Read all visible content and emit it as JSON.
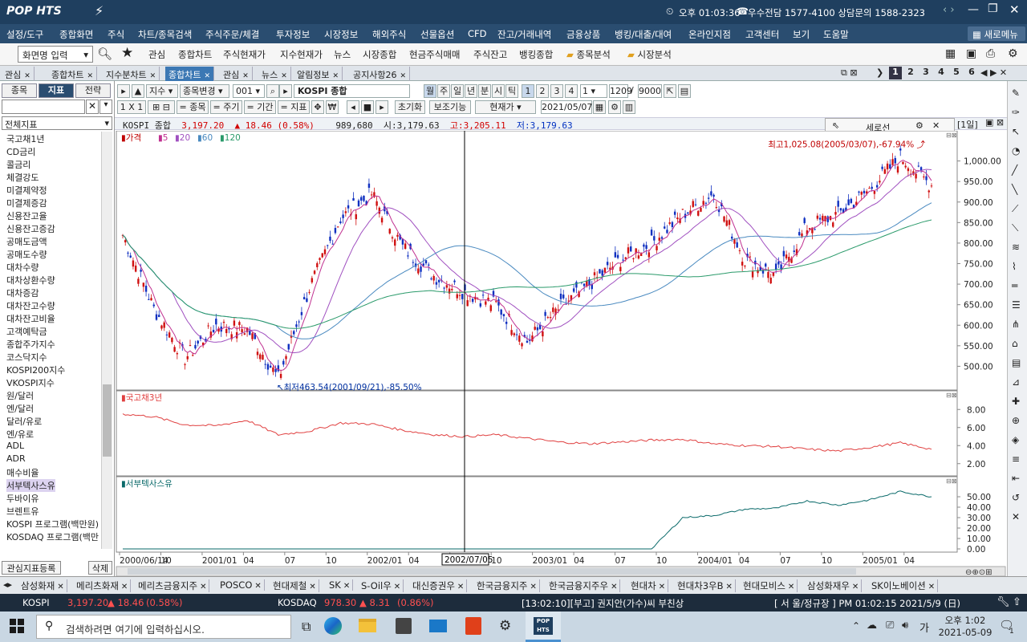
{
  "app": {
    "logo": "POP HTS",
    "clock": "오후 01:03:36",
    "contact": "우수전담 1577-4100 상담문의 1588-2323",
    "new_menu": "새로메뉴"
  },
  "menu": [
    "설정/도구",
    "종합화면",
    "주식",
    "차트/종목검색",
    "주식주문/체결",
    "투자정보",
    "시장정보",
    "해외주식",
    "선물옵션",
    "CFD",
    "잔고/거래내역",
    "금융상품",
    "뱅킹/대출/대여",
    "온라인지점",
    "고객센터",
    "보기",
    "도움말"
  ],
  "toolbar": {
    "screen_input": "화면명 입력",
    "links": [
      "관심",
      "종합차트",
      "주식현재가",
      "지수현재가",
      "뉴스",
      "시장종합",
      "현금주식매매",
      "주식잔고",
      "뱅킹종합"
    ],
    "folders": [
      "종목분석",
      "시장분석"
    ]
  },
  "window_tabs": [
    "관심",
    "종합차트",
    "지수분차트",
    "종합차트",
    "관심",
    "뉴스",
    "알림정보",
    "공지사항26"
  ],
  "window_tab_active": 3,
  "page_tabs": [
    "1",
    "2",
    "3",
    "4",
    "5",
    "6"
  ],
  "left": {
    "tabs": [
      "종목",
      "지표",
      "전략"
    ],
    "active_tab": 1,
    "filter": "전체지표",
    "items": [
      "국고채1년",
      "CD금리",
      "콜금리",
      "체결강도",
      "미결제약정",
      "미결제증감",
      "신용잔고율",
      "신용잔고증감",
      "공매도금액",
      "공매도수량",
      "대차수량",
      "대차상환수량",
      "대차증감",
      "대차잔고수량",
      "대차잔고비율",
      "고객예탁금",
      "종합주가지수",
      "코스닥지수",
      "KOSPI200지수",
      "VKOSPI지수",
      "원/달러",
      "엔/달러",
      "달러/유로",
      "엔/유로",
      "ADL",
      "ADR",
      "매수비율",
      "서부텍사스유",
      "두바이유",
      "브렌트유",
      "KOSPI 프로그램(백만원)",
      "KOSDAQ 프로그램(백만"
    ],
    "selected": "서부텍사스유",
    "register": "관심지표등록",
    "delete": "삭제"
  },
  "chart_ctrl": {
    "index_label": "지수",
    "change_label": "종목변경",
    "code": "001",
    "name": "KOSPI 종합",
    "periods": [
      "월",
      "주",
      "일",
      "년",
      "분",
      "시",
      "틱"
    ],
    "nums": [
      "1",
      "2",
      "3",
      "4"
    ],
    "count_sel": "1",
    "count1": "1209",
    "count2": "9000",
    "btn_a": "1 X 1",
    "btn_b": "= 종목",
    "btn_c": "= 주기",
    "btn_d": "= 기간",
    "btn_e": "= 지표",
    "reset": "초기화",
    "aux": "보조기능",
    "price_type": "현재가",
    "date": "2021/05/07"
  },
  "quote": {
    "name": "KOSPI 종합",
    "price": "3,197.20",
    "change": "▲ 18.46",
    "pct": "(0.58%)",
    "volume": "989,680",
    "open_label": "시:",
    "open": "3,179.63",
    "high_label": "고:",
    "high": "3,205.11",
    "low_label": "저:",
    "low": "3,179.63"
  },
  "crosshair_panel": {
    "label": "세로선",
    "period_box": "[1일]"
  },
  "chart_data": [
    {
      "type": "candlestick",
      "title": "가격",
      "legend": [
        {
          "name": "5",
          "color": "#c03090"
        },
        {
          "name": "20",
          "color": "#a050c0"
        },
        {
          "name": "60",
          "color": "#4a8ac0"
        },
        {
          "name": "120",
          "color": "#2a9a6a"
        }
      ],
      "x": [
        "2000/06",
        "2000/09",
        "2000/12",
        "2001/03",
        "2001/06",
        "2001/09",
        "2001/12",
        "2002/02",
        "2002/04",
        "2002/06",
        "2002/08",
        "2002/10",
        "2002/12",
        "2003/03",
        "2003/05",
        "2003/07",
        "2003/09",
        "2003/11",
        "2004/01",
        "2004/04",
        "2004/05",
        "2004/07",
        "2004/09",
        "2004/11",
        "2005/01",
        "2005/03",
        "2005/05"
      ],
      "close": [
        820,
        640,
        520,
        600,
        590,
        470,
        690,
        860,
        920,
        790,
        720,
        680,
        650,
        560,
        640,
        700,
        760,
        800,
        870,
        920,
        760,
        720,
        840,
        870,
        930,
        1010,
        940
      ],
      "ylim": [
        450,
        1050
      ],
      "yticks": [
        "1,000.00",
        "950.00",
        "900.00",
        "850.00",
        "800.00",
        "750.00",
        "700.00",
        "650.00",
        "600.00",
        "550.00",
        "500.00"
      ],
      "annotations": [
        {
          "text": "최고1,025.08(2005/03/07),-67.94%",
          "color": "#c00000"
        },
        {
          "text": "최저463.54(2001/09/21),-85.50%",
          "color": "#0030a0"
        }
      ]
    },
    {
      "type": "line",
      "title": "국고채3년",
      "color": "#e04040",
      "ylim": [
        1,
        9
      ],
      "yticks": [
        "8.00",
        "6.00",
        "4.00",
        "2.00"
      ],
      "values": [
        7.5,
        7.2,
        6.3,
        6.2,
        6.8,
        5.2,
        5.6,
        6.5,
        6.4,
        5.7,
        5.2,
        5.0,
        5.2,
        4.8,
        4.4,
        4.2,
        4.4,
        4.6,
        4.7,
        4.2,
        4.0,
        3.9,
        3.6,
        3.4,
        3.8,
        4.3,
        3.6
      ]
    },
    {
      "type": "line",
      "title": "서부텍사스유",
      "color": "#0a6a6a",
      "ylim": [
        0,
        60
      ],
      "yticks": [
        "50.00",
        "40.00",
        "30.00",
        "20.00",
        "10.00",
        "0.00"
      ],
      "values": [
        0,
        0,
        0,
        0,
        0,
        0,
        0,
        0,
        0,
        0,
        0,
        0,
        0,
        0,
        0,
        0,
        0,
        0,
        30,
        32,
        38,
        39,
        46,
        42,
        47,
        55,
        50
      ]
    }
  ],
  "xaxis": {
    "labels": [
      "2000/06/14",
      "10",
      "2001/01",
      "04",
      "07",
      "10",
      "2002/01",
      "04",
      "07",
      "10",
      "2003/01",
      "04",
      "07",
      "10",
      "2004/01",
      "04",
      "07",
      "10",
      "2005/01",
      "04"
    ],
    "cursor_label": "2002/07/05"
  },
  "stock_tabs": [
    "삼성화재",
    "메리츠화재",
    "메리츠금융지주",
    "POSCO",
    "현대제철",
    "SK",
    "S-Oil우",
    "대신증권우",
    "한국금융지주",
    "한국금융지주우",
    "현대차",
    "현대차3우B",
    "현대모비스",
    "삼성화재우",
    "SK이노베이션"
  ],
  "status": {
    "kospi_label": "KOSPI",
    "kospi": "3,197.20",
    "kospi_chg": "▲ 18.46",
    "kospi_pct": "(0.58%)",
    "kosdaq_label": "KOSDAQ",
    "kosdaq": "978.30",
    "kosdaq_chg": "▲ 8.31",
    "kosdaq_pct": "(0.86%)",
    "news": "[13:02:10][부고] 권지안(가수)씨 부친상",
    "server": "[ 서  울/정규장 ] PM 01:02:15  2021/5/9 (日)"
  },
  "taskbar": {
    "search": "검색하려면 여기에 입력하십시오.",
    "time": "오후 1:02",
    "date": "2021-05-09",
    "ime": "가",
    "notify": "1"
  }
}
